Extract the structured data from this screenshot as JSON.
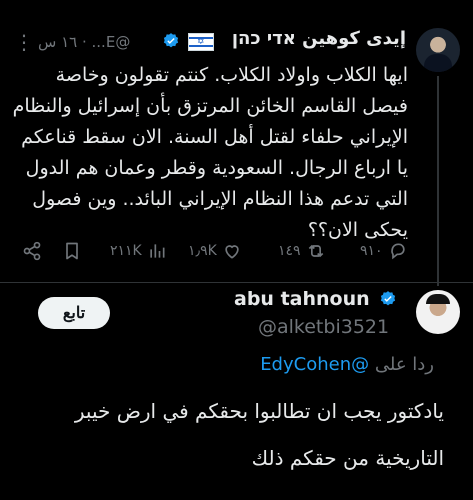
{
  "tweet": {
    "author_name": "إيدى كوهين אדי כהן",
    "flag": "🇮🇱",
    "handle_time": "@E... · ١٦ س",
    "text": "ايها الكلاب واولاد الكلاب. كنتم تقولون وخاصة\nفيصل القاسم الخائن المرتزق بأن إسرائيل والنظام\nالإيراني حلفاء لقتل أهل السنة. الان سقط قناعكم\nيا ارباع الرجال. السعودية وقطر وعمان هم الدول\nالتي تدعم هذا النظام الإيراني البائد.. وين فصول\nيحكى الان؟؟",
    "replies": "٩١٠",
    "retweets": "١٤٩",
    "likes": "١٫٩K",
    "views": "٢١١K"
  },
  "reply": {
    "author_name": "abu tahnoun",
    "handle": "@alketbi3521",
    "follow_label": "تابع",
    "replying_label": "ردا على",
    "replying_mention": "@EdyCohen",
    "text": "يادكتور يجب ان تطالبوا بحقكم في ارض خيبر\nالتاريخية من حقكم ذلك"
  },
  "colors": {
    "background": "#000000",
    "text": "#e7e9ea",
    "muted": "#71767b",
    "accent": "#1d9bf0",
    "divider": "#2f3336"
  }
}
